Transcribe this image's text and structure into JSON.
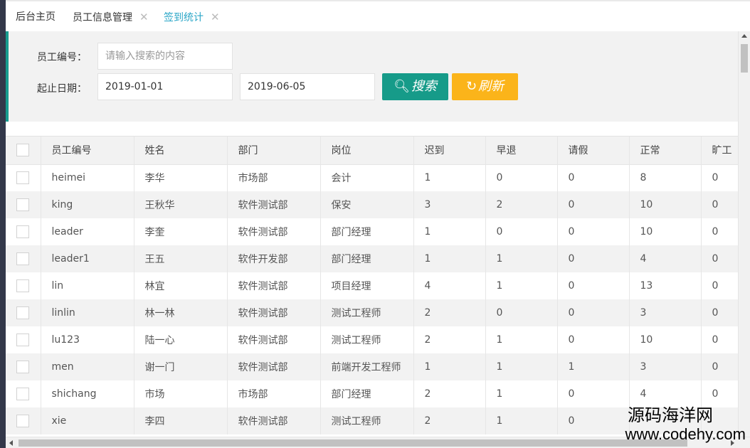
{
  "tabs": [
    {
      "label": "后台主页",
      "closable": false,
      "active": false
    },
    {
      "label": "员工信息管理",
      "closable": true,
      "active": false
    },
    {
      "label": "签到统计",
      "closable": true,
      "active": true
    }
  ],
  "close_glyph": "✕",
  "search": {
    "employee_id_label": "员工编号：",
    "employee_id_placeholder": "请输入搜索的内容",
    "date_range_label": "起止日期：",
    "start_date": "2019-01-01",
    "end_date": "2019-06-05",
    "search_button": "搜索",
    "refresh_button": "刷新"
  },
  "colors": {
    "accent": "#169b89",
    "refresh": "#fbb41a",
    "active_tab": "#2aa6c7"
  },
  "table": {
    "columns": [
      "员工编号",
      "姓名",
      "部门",
      "岗位",
      "迟到",
      "早退",
      "请假",
      "正常",
      "旷工"
    ],
    "rows": [
      [
        "heimei",
        "李华",
        "市场部",
        "会计",
        "1",
        "0",
        "0",
        "8",
        "0"
      ],
      [
        "king",
        "王秋华",
        "软件测试部",
        "保安",
        "3",
        "2",
        "0",
        "10",
        "0"
      ],
      [
        "leader",
        "李奎",
        "软件测试部",
        "部门经理",
        "1",
        "0",
        "0",
        "10",
        "0"
      ],
      [
        "leader1",
        "王五",
        "软件开发部",
        "部门经理",
        "1",
        "1",
        "0",
        "4",
        "0"
      ],
      [
        "lin",
        "林宜",
        "软件测试部",
        "项目经理",
        "4",
        "1",
        "0",
        "13",
        "0"
      ],
      [
        "linlin",
        "林一林",
        "软件测试部",
        "测试工程师",
        "2",
        "0",
        "0",
        "3",
        "0"
      ],
      [
        "lu123",
        "陆一心",
        "软件测试部",
        "测试工程师",
        "2",
        "1",
        "0",
        "10",
        "0"
      ],
      [
        "men",
        "谢一门",
        "软件测试部",
        "前端开发工程师",
        "1",
        "1",
        "1",
        "3",
        "0"
      ],
      [
        "shichang",
        "市场",
        "市场部",
        "部门经理",
        "2",
        "1",
        "0",
        "4",
        "0"
      ],
      [
        "xie",
        "李四",
        "软件测试部",
        "测试工程师",
        "2",
        "1",
        "0",
        "",
        ""
      ]
    ]
  },
  "watermark": {
    "cn": "源码海洋网",
    "url": "www.codehy.com"
  }
}
